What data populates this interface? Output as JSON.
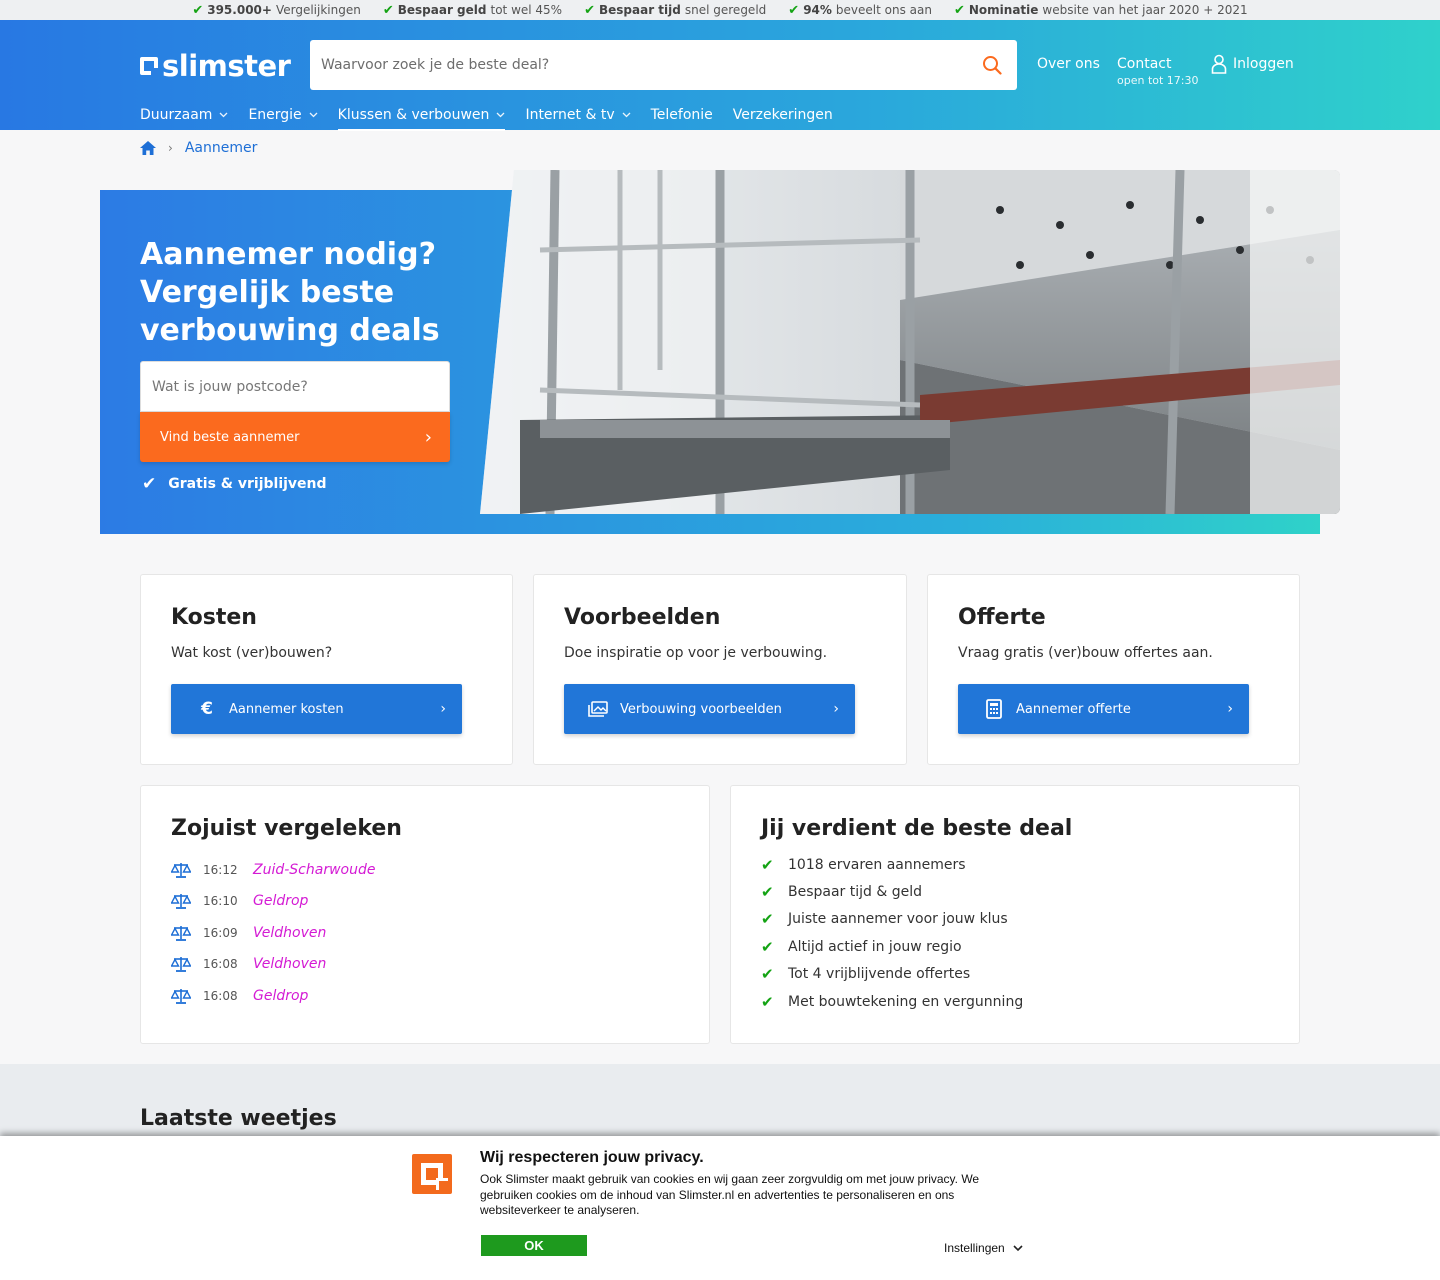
{
  "usp_bar": [
    {
      "bold": "395.000+",
      "text": "Vergelijkingen"
    },
    {
      "bold": "Bespaar geld",
      "text": "tot wel 45%"
    },
    {
      "bold": "Bespaar tijd",
      "text": "snel geregeld"
    },
    {
      "bold": "94%",
      "text": "beveelt ons aan"
    },
    {
      "bold": "Nominatie",
      "text": "website van het jaar 2020 + 2021"
    }
  ],
  "header": {
    "logo": "slimster",
    "search_placeholder": "Waarvoor zoek je de beste deal?",
    "about": "Over ons",
    "contact": "Contact",
    "contact_hours": "open tot 17:30",
    "login": "Inloggen"
  },
  "nav": [
    {
      "label": "Duurzaam",
      "dropdown": true
    },
    {
      "label": "Energie",
      "dropdown": true
    },
    {
      "label": "Klussen & verbouwen",
      "dropdown": true,
      "active": true
    },
    {
      "label": "Internet & tv",
      "dropdown": true
    },
    {
      "label": "Telefonie",
      "dropdown": false
    },
    {
      "label": "Verzekeringen",
      "dropdown": false
    }
  ],
  "breadcrumb": {
    "current": "Aannemer"
  },
  "hero": {
    "title": "Aannemer nodig? Vergelijk beste verbouwing deals",
    "postcode_placeholder": "Wat is jouw postcode?",
    "cta": "Vind beste aannemer",
    "free": "Gratis & vrijblijvend"
  },
  "cards": [
    {
      "title": "Kosten",
      "subtitle": "Wat kost (ver)bouwen?",
      "button": "Aannemer kosten",
      "icon": "euro-icon"
    },
    {
      "title": "Voorbeelden",
      "subtitle": "Doe inspiratie op voor je verbouwing.",
      "button": "Verbouwing voorbeelden",
      "icon": "images-icon"
    },
    {
      "title": "Offerte",
      "subtitle": "Vraag gratis (ver)bouw offertes aan.",
      "button": "Aannemer offerte",
      "icon": "calculator-icon"
    }
  ],
  "recent": {
    "title": "Zojuist vergeleken",
    "rows": [
      {
        "time": "16:12",
        "place": "Zuid-Scharwoude"
      },
      {
        "time": "16:10",
        "place": "Geldrop"
      },
      {
        "time": "16:09",
        "place": "Veldhoven"
      },
      {
        "time": "16:08",
        "place": "Veldhoven"
      },
      {
        "time": "16:08",
        "place": "Geldrop"
      }
    ]
  },
  "deal": {
    "title": "Jij verdient de beste deal",
    "items": [
      "1018 ervaren aannemers",
      "Bespaar tijd & geld",
      "Juiste aannemer voor jouw klus",
      "Altijd actief in jouw regio",
      "Tot 4 vrijblijvende offertes",
      "Met bouwtekening en vergunning"
    ]
  },
  "weetjes": {
    "title": "Laatste weetjes"
  },
  "cookie": {
    "title": "Wij respecteren jouw privacy.",
    "text": "Ook Slimster maakt gebruik van cookies en wij gaan zeer zorgvuldig om met jouw privacy. We gebruiken cookies om de inhoud van Slimster.nl en advertenties te personaliseren en ons websiteverkeer te analyseren.",
    "ok": "OK",
    "settings": "Instellingen"
  },
  "colors": {
    "brand_blue": "#2878e3",
    "brand_teal": "#2fd1cb",
    "cta_orange": "#fb6a1e",
    "button_blue": "#2176d8",
    "check_green": "#14a314"
  }
}
